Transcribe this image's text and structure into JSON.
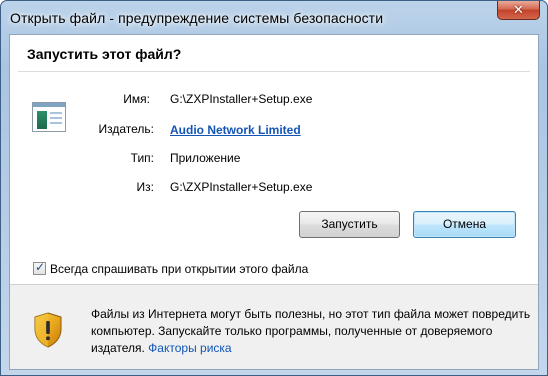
{
  "window": {
    "title": "Открыть файл - предупреждение системы безопасности",
    "close_label": "✕"
  },
  "dialog": {
    "question": "Запустить этот файл?",
    "fields": {
      "name_label": "Имя:",
      "name_value": "G:\\ZXPInstaller+Setup.exe",
      "publisher_label": "Издатель:",
      "publisher_value": "Audio Network Limited",
      "type_label": "Тип:",
      "type_value": "Приложение",
      "from_label": "Из:",
      "from_value": "G:\\ZXPInstaller+Setup.exe"
    },
    "buttons": {
      "run_label": "Запустить",
      "cancel_label": "Отмена"
    },
    "checkbox": {
      "label": "Всегда спрашивать при открытии этого файла",
      "checked": true
    },
    "warning": {
      "text": "Файлы из Интернета могут быть полезны, но этот тип файла может повредить компьютер. Запускайте только программы, полученные от доверяемого издателя.",
      "link": "Факторы риска"
    }
  },
  "icons": {
    "app": "application-icon",
    "shield": "security-shield-icon",
    "close": "close-icon"
  },
  "colors": {
    "link": "#1255b6",
    "default_button_border": "#3c7fb1",
    "close_button": "#c4422a"
  }
}
